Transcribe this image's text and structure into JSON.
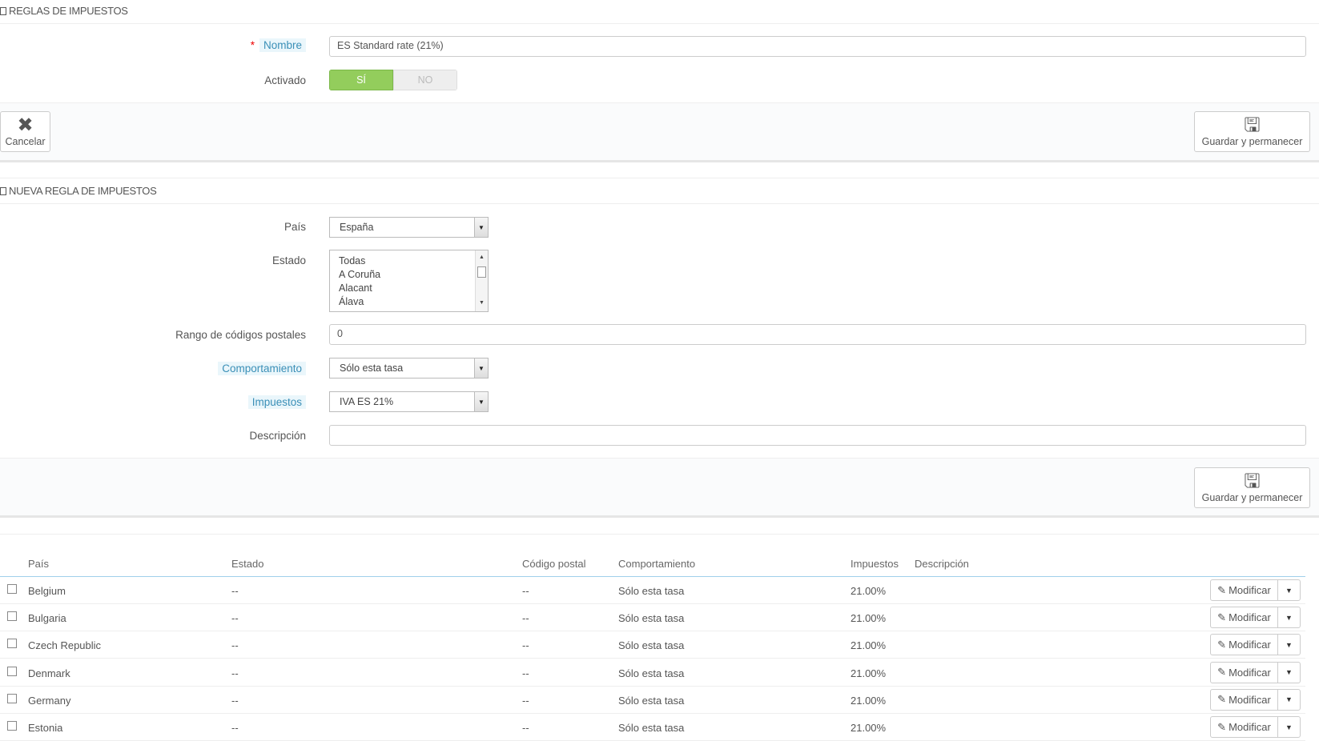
{
  "rule_panel": {
    "title": "Reglas de impuestos",
    "name_label": "Nombre",
    "name_value": "ES Standard rate (21%)",
    "enabled_label": "Activado",
    "yes": "SÍ",
    "no": "NO",
    "cancel": "Cancelar",
    "save": "Guardar y permanecer"
  },
  "new_rule_panel": {
    "title": "Nueva regla de impuestos",
    "country_label": "País",
    "country_value": "España",
    "state_label": "Estado",
    "states": [
      "Todas",
      "A Coruña",
      "Alacant",
      "Álava"
    ],
    "zip_label": "Rango de códigos postales",
    "zip_value": "0",
    "behavior_label": "Comportamiento",
    "behavior_value": "Sólo esta tasa",
    "tax_label": "Impuestos",
    "tax_value": "IVA ES 21%",
    "desc_label": "Descripción",
    "desc_value": "",
    "save": "Guardar y permanecer"
  },
  "table": {
    "headers": [
      "País",
      "Estado",
      "Código postal",
      "Comportamiento",
      "Impuestos",
      "Descripción"
    ],
    "edit_label": "Modificar",
    "rows": [
      {
        "country": "Belgium",
        "state": "--",
        "zip": "--",
        "behavior": "Sólo esta tasa",
        "tax": "21.00%"
      },
      {
        "country": "Bulgaria",
        "state": "--",
        "zip": "--",
        "behavior": "Sólo esta tasa",
        "tax": "21.00%"
      },
      {
        "country": "Czech Republic",
        "state": "--",
        "zip": "--",
        "behavior": "Sólo esta tasa",
        "tax": "21.00%"
      },
      {
        "country": "Denmark",
        "state": "--",
        "zip": "--",
        "behavior": "Sólo esta tasa",
        "tax": "21.00%"
      },
      {
        "country": "Germany",
        "state": "--",
        "zip": "--",
        "behavior": "Sólo esta tasa",
        "tax": "21.00%"
      },
      {
        "country": "Estonia",
        "state": "--",
        "zip": "--",
        "behavior": "Sólo esta tasa",
        "tax": "21.00%"
      }
    ]
  }
}
